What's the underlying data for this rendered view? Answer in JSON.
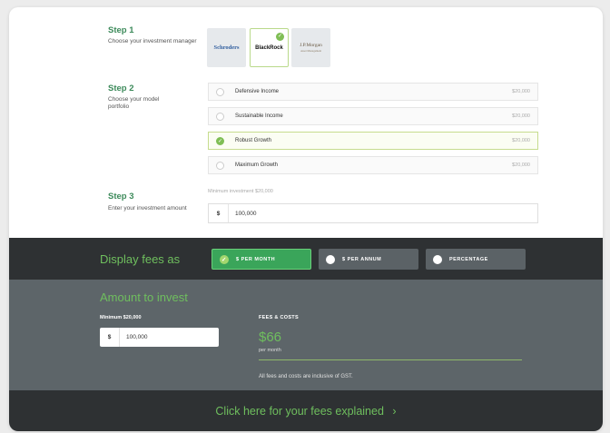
{
  "step1": {
    "title": "Step 1",
    "desc": "Choose your investment manager",
    "managers": [
      {
        "name": "Schroders",
        "selected": false
      },
      {
        "name": "BlackRock",
        "selected": true
      },
      {
        "name": "J.P.Morgan",
        "sub": "Asset Management",
        "selected": false
      }
    ]
  },
  "step2": {
    "title": "Step 2",
    "desc": "Choose your model portfolio",
    "options": [
      {
        "label": "Defensive Income",
        "amount": "$20,000",
        "selected": false
      },
      {
        "label": "Sustainable Income",
        "amount": "$20,000",
        "selected": false
      },
      {
        "label": "Robust Growth",
        "amount": "$20,000",
        "selected": true
      },
      {
        "label": "Maximum Growth",
        "amount": "$20,000",
        "selected": false
      }
    ]
  },
  "step3": {
    "title": "Step 3",
    "desc": "Enter your investment amount",
    "min_note": "Minimum investment $20,000",
    "currency": "$",
    "value": "100,000"
  },
  "fees_display": {
    "label": "Display fees as",
    "options": [
      {
        "label": "$ PER MONTH",
        "active": true
      },
      {
        "label": "$ PER ANNUM",
        "active": false
      },
      {
        "label": "PERCENTAGE",
        "active": false
      }
    ]
  },
  "invest_panel": {
    "title": "Amount to invest",
    "min_label": "Minimum $20,000",
    "currency": "$",
    "value": "100,000",
    "costs_label": "FEES & COSTS",
    "fee_amount": "$66",
    "fee_period": "per month",
    "gst_note": "All fees and costs are inclusive of GST."
  },
  "cta": {
    "label": "Click here for your fees explained",
    "arrow": "›"
  },
  "colors": {
    "accent_green": "#6fbf5e",
    "dark_bar": "#2e3133",
    "panel_grey": "#5d6569"
  }
}
